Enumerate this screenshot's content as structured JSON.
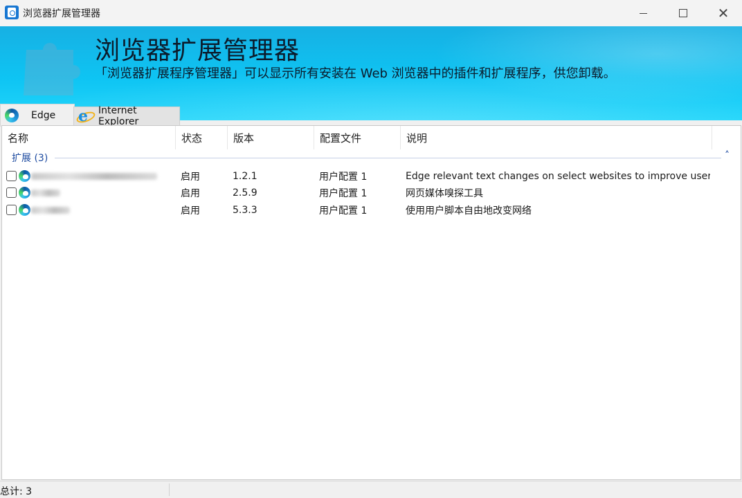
{
  "window": {
    "title": "浏览器扩展管理器"
  },
  "banner": {
    "title": "浏览器扩展管理器",
    "subtitle": "「浏览器扩展程序管理器」可以显示所有安装在 Web 浏览器中的插件和扩展程序，供您卸载。"
  },
  "tabs": [
    {
      "label": "Edge",
      "icon": "edge-icon",
      "selected": true
    },
    {
      "label": "Internet Explorer",
      "icon": "ie-icon",
      "selected": false
    }
  ],
  "columns": [
    "名称",
    "状态",
    "版本",
    "配置文件",
    "说明"
  ],
  "group": {
    "label": "扩展 (3)"
  },
  "rows": [
    {
      "status": "启用",
      "version": "1.2.1",
      "profile": "用户配置 1",
      "description": "Edge relevant text changes on select websites to improve user e..."
    },
    {
      "status": "启用",
      "version": "2.5.9",
      "profile": "用户配置 1",
      "description": "网页媒体嗅探工具"
    },
    {
      "status": "启用",
      "version": "5.3.3",
      "profile": "用户配置 1",
      "description": "使用用户脚本自由地改变网络"
    }
  ],
  "statusbar": {
    "count_text": "总计: 3"
  },
  "colors": {
    "banner_top": "#17b0e3",
    "banner_bottom": "#22d6fb",
    "group_text": "#1e4ba0"
  }
}
